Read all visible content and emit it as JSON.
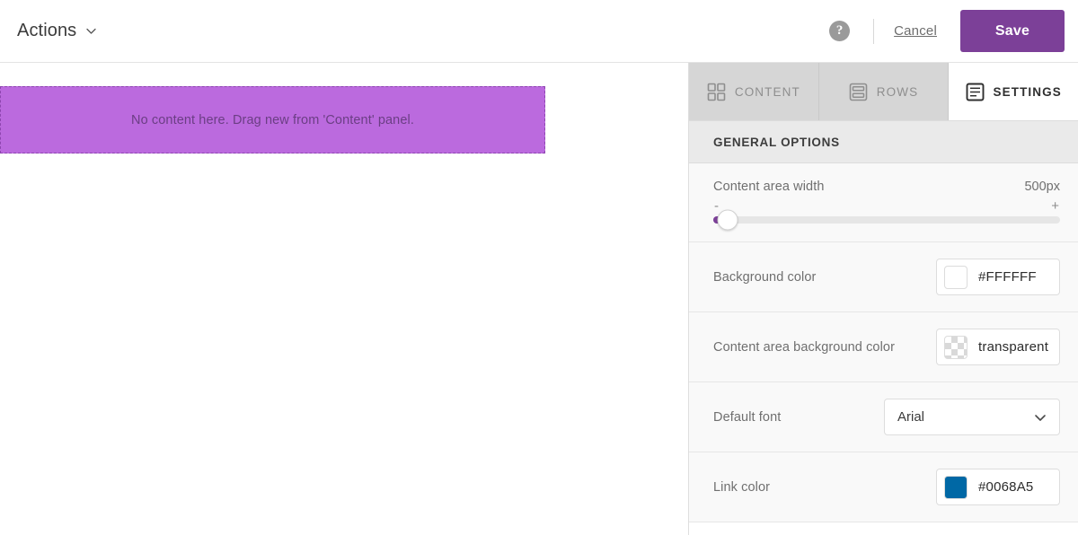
{
  "topbar": {
    "actions_label": "Actions",
    "actions_chevron_icon": "chevron-down-icon",
    "help_icon": "help-question-icon",
    "help_glyph": "?",
    "cancel_label": "Cancel",
    "save_label": "Save",
    "save_color": "#7C4098"
  },
  "canvas": {
    "dropzone_text": "No content here. Drag new from 'Content' panel.",
    "dropzone_fill": "#BB6ADE",
    "dropzone_border": "#8E45B0"
  },
  "panel": {
    "tabs": [
      {
        "label": "CONTENT",
        "icon": "grid-squares-icon",
        "active": false
      },
      {
        "label": "ROWS",
        "icon": "stacked-rows-icon",
        "active": false
      },
      {
        "label": "SETTINGS",
        "icon": "document-lines-icon",
        "active": true
      }
    ],
    "section_title": "GENERAL OPTIONS",
    "options": {
      "content_area_width": {
        "label": "Content area width",
        "value": "500px",
        "minus_sign": "-",
        "plus_sign": "+",
        "fill_color": "#7C4098"
      },
      "background_color": {
        "label": "Background color",
        "value": "#FFFFFF",
        "swatch_color": "#FFFFFF"
      },
      "content_area_background_color": {
        "label": "Content area background color",
        "value": "transparent",
        "swatch_color": "transparent"
      },
      "default_font": {
        "label": "Default font",
        "value": "Arial",
        "chevron_icon": "chevron-down-icon"
      },
      "link_color": {
        "label": "Link color",
        "value": "#0068A5",
        "swatch_color": "#0068A5"
      }
    }
  }
}
